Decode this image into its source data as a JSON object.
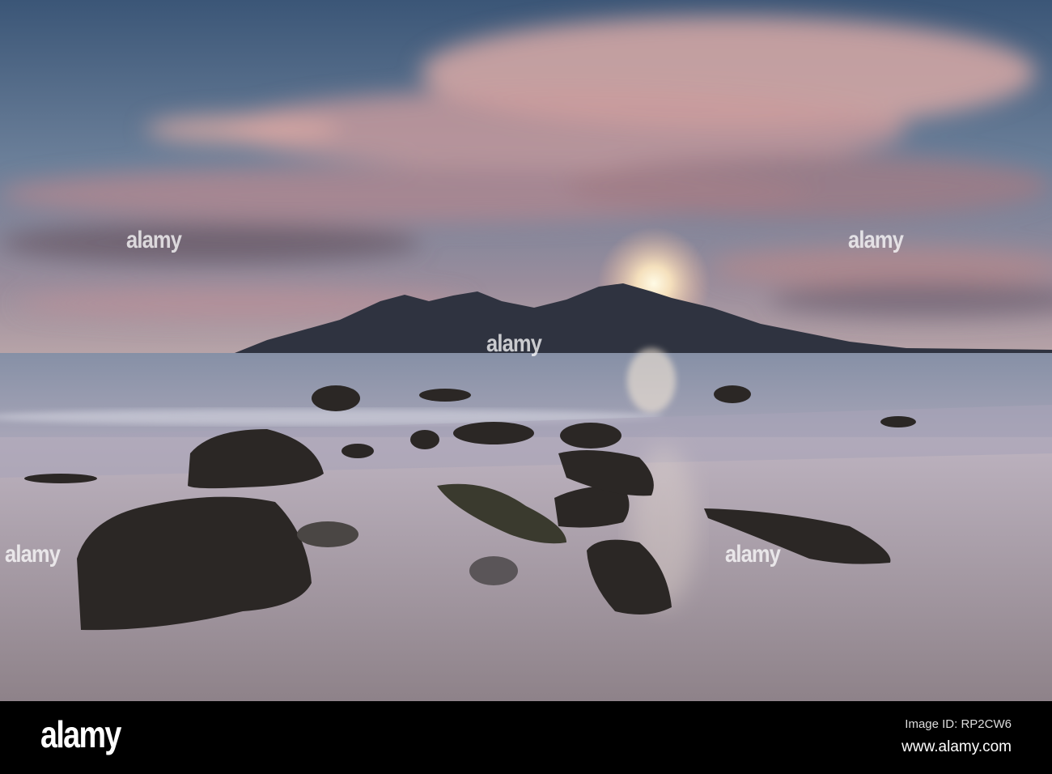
{
  "watermark": {
    "logo_text": "alamy",
    "image_id": "Image ID: RP2CW6",
    "website": "www.alamy.com",
    "overlay_text": "alamy"
  },
  "colors": {
    "sky_top": "#3d5a7a",
    "cloud_pink": "#d8a0a0",
    "sun": "#fff6d8",
    "mountain": "#2e3340",
    "sea": "#8a93a8",
    "sand": "#b9adb6",
    "rock": "#2a2624"
  }
}
